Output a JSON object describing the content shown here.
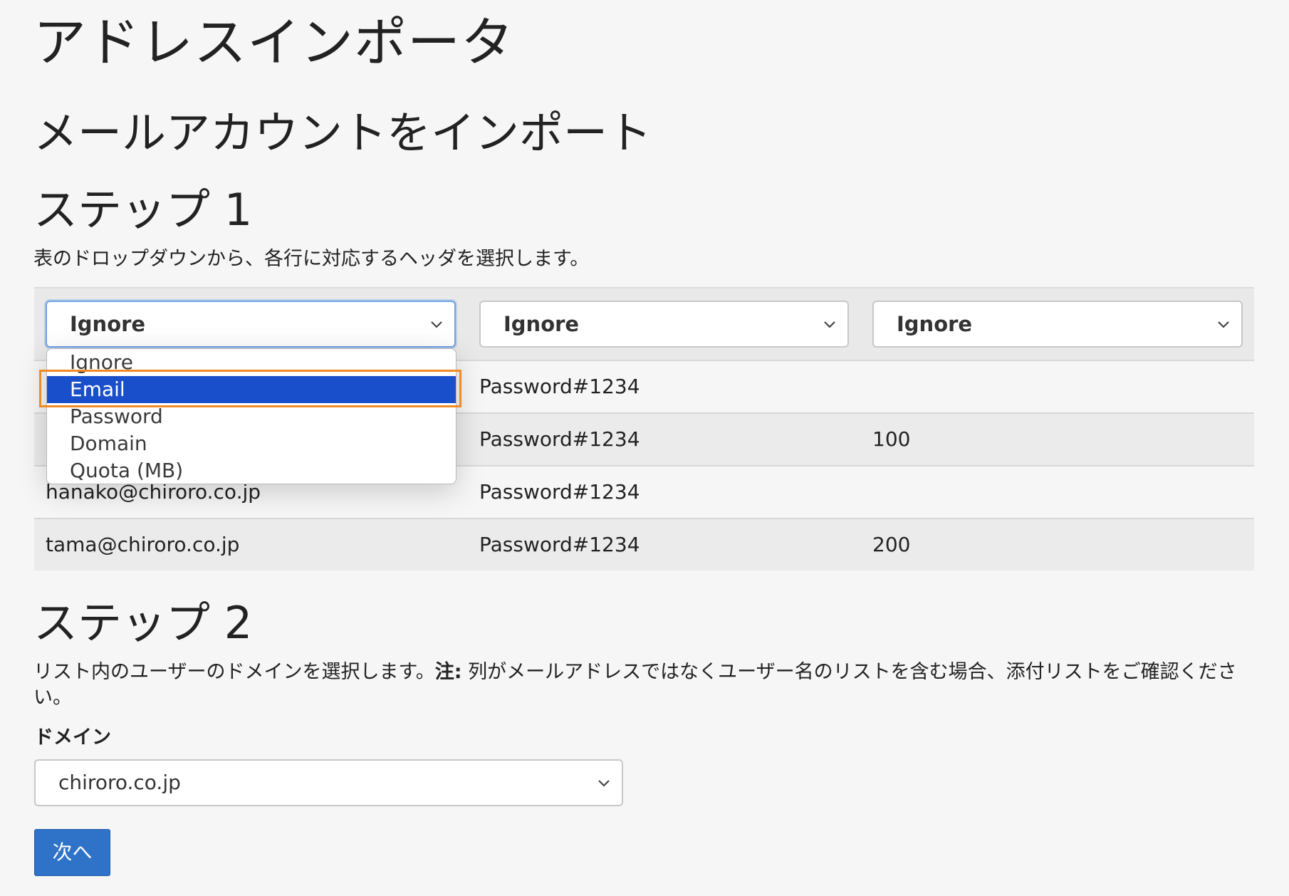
{
  "page": {
    "title": "アドレスインポータ",
    "section_title": "メールアカウントをインポート"
  },
  "step1": {
    "title": "ステップ 1",
    "description": "表のドロップダウンから、各行に対応するヘッダを選択します。",
    "column_selects": [
      "Ignore",
      "Ignore",
      "Ignore"
    ],
    "dropdown_options": [
      "Ignore",
      "Email",
      "Password",
      "Domain",
      "Quota (MB)"
    ],
    "dropdown_highlighted": "Email",
    "rows": [
      [
        "",
        "Password#1234",
        ""
      ],
      [
        "",
        "Password#1234",
        "100"
      ],
      [
        "hanako@chiroro.co.jp",
        "Password#1234",
        ""
      ],
      [
        "tama@chiroro.co.jp",
        "Password#1234",
        "200"
      ]
    ]
  },
  "step2": {
    "title": "ステップ 2",
    "description_prefix": "リスト内のユーザーのドメインを選択します。",
    "note_label": "注:",
    "description_note": " 列がメールアドレスではなくユーザー名のリストを含む場合、添付リストをご確認ください。",
    "domain_label": "ドメイン",
    "domain_value": "chiroro.co.jp",
    "next_button": "次へ"
  },
  "colors": {
    "accent_button": "#2e73c8",
    "selected_option": "#1a4fcb",
    "highlight_box": "#f08a24"
  }
}
